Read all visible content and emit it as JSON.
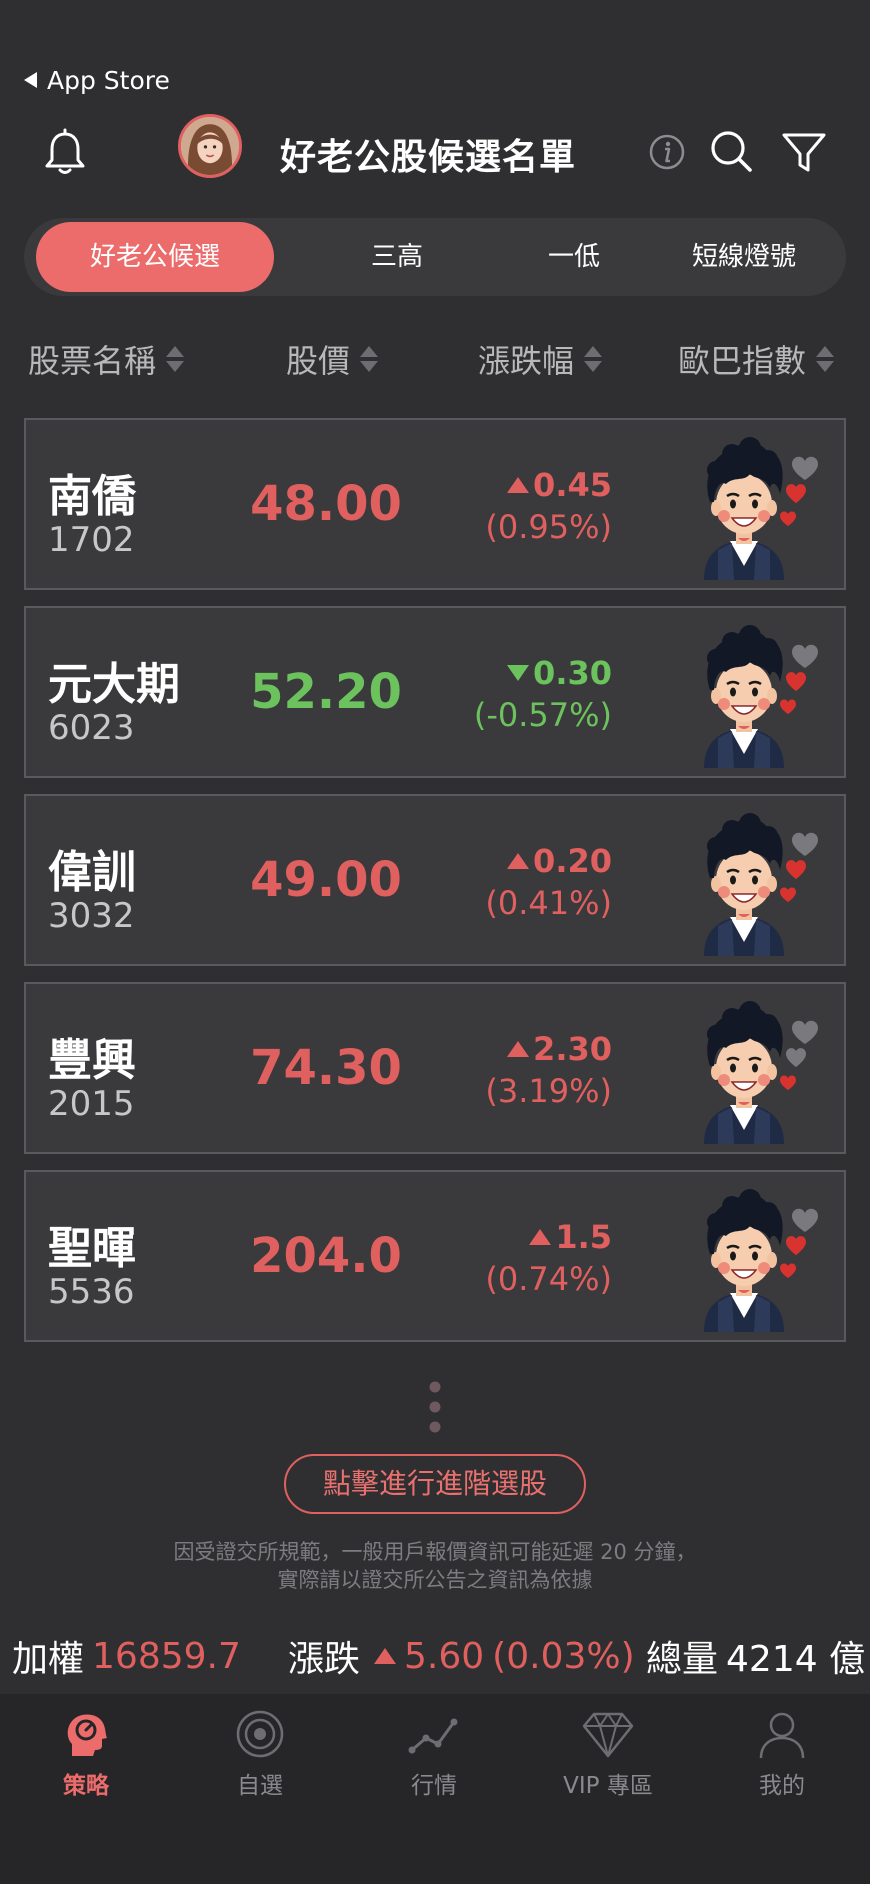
{
  "status_bar": {
    "back_label": "App Store"
  },
  "header": {
    "title": "好老公股候選名單"
  },
  "tabs": [
    {
      "label": "好老公候選",
      "active": true
    },
    {
      "label": "三高",
      "active": false
    },
    {
      "label": "一低",
      "active": false
    },
    {
      "label": "短線燈號",
      "active": false
    }
  ],
  "columns": {
    "name": "股票名稱",
    "price": "股價",
    "change": "漲跌幅",
    "obama_index": "歐巴指數"
  },
  "stocks": [
    {
      "name": "南僑",
      "code": "1702",
      "price": "48.00",
      "change": "0.45",
      "pct": "(0.95%)",
      "direction": "up",
      "hearts": 2
    },
    {
      "name": "元大期",
      "code": "6023",
      "price": "52.20",
      "change": "0.30",
      "pct": "(-0.57%)",
      "direction": "down",
      "hearts": 2
    },
    {
      "name": "偉訓",
      "code": "3032",
      "price": "49.00",
      "change": "0.20",
      "pct": "(0.41%)",
      "direction": "up",
      "hearts": 2
    },
    {
      "name": "豐興",
      "code": "2015",
      "price": "74.30",
      "change": "2.30",
      "pct": "(3.19%)",
      "direction": "up",
      "hearts": 1
    },
    {
      "name": "聖暉",
      "code": "5536",
      "price": "204.0",
      "change": "1.5",
      "pct": "(0.74%)",
      "direction": "up",
      "hearts": 2
    }
  ],
  "advanced_button": "點擊進行進階選股",
  "disclaimer": {
    "line1": "因受證交所規範，一般用戶報價資訊可能延遲 20 分鐘，",
    "line2": "實際請以證交所公告之資訊為依據"
  },
  "index_bar": {
    "weighted_label": "加權",
    "weighted_value": "16859.7",
    "change_label": "漲跌",
    "change_value": "5.60",
    "change_pct": "(0.03%)",
    "volume_label": "總量",
    "volume_value": "4214 億"
  },
  "bottom_nav": [
    {
      "label": "策略",
      "icon": "head-icon",
      "active": true
    },
    {
      "label": "自選",
      "icon": "target-icon",
      "active": false
    },
    {
      "label": "行情",
      "icon": "chart-line-icon",
      "active": false
    },
    {
      "label": "VIP 專區",
      "icon": "diamond-icon",
      "active": false
    },
    {
      "label": "我的",
      "icon": "user-icon",
      "active": false
    }
  ],
  "colors": {
    "background": "#2f2f31",
    "card": "#3a3a3c",
    "accent": "#ec6b6b",
    "up": "#e0605f",
    "down": "#6cc35e"
  }
}
